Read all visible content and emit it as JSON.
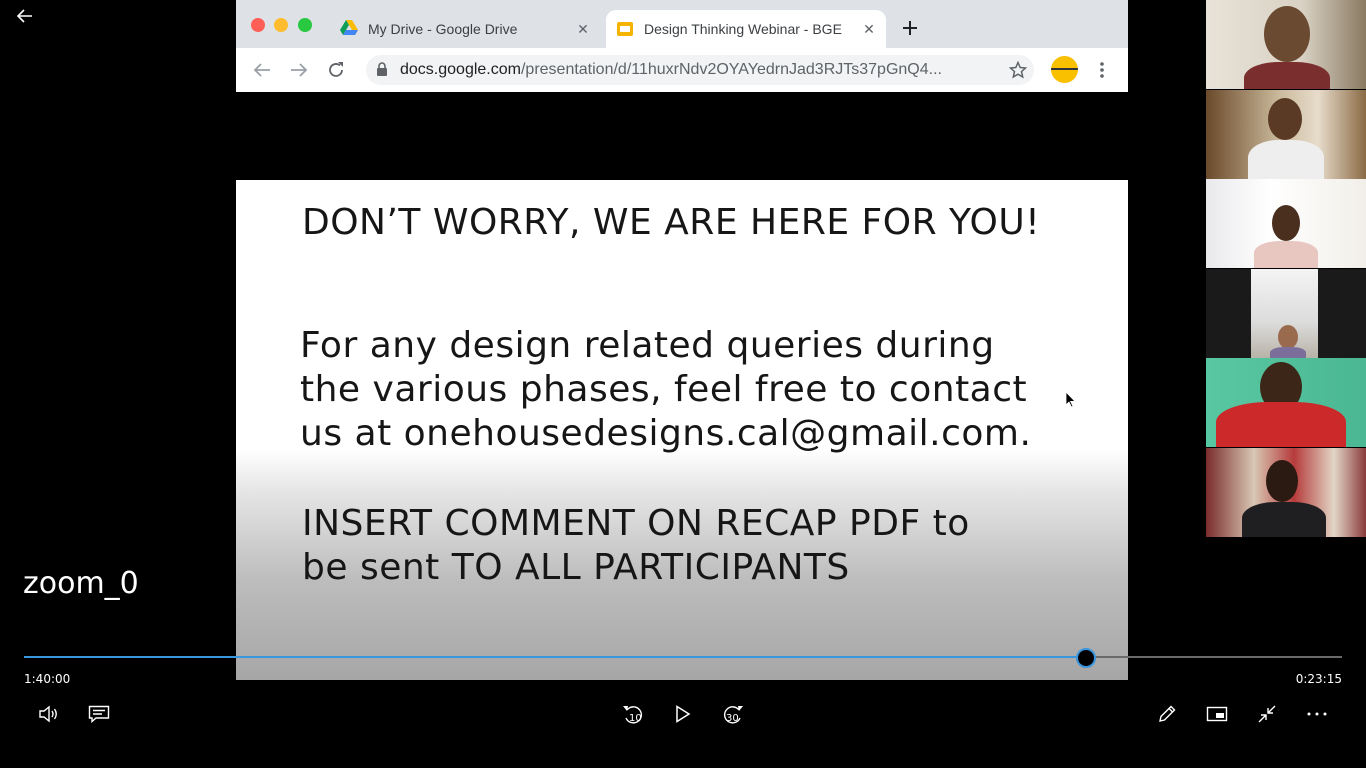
{
  "player": {
    "recording_title": "zoom_0",
    "elapsed_time": "1:40:00",
    "remaining_time": "0:23:15",
    "progress_fraction": 0.806,
    "skip_back_seconds": "10",
    "skip_forward_seconds": "30",
    "accent_color": "#3a96dd",
    "controls": [
      "back-arrow-icon",
      "volume-icon",
      "captions-icon",
      "skip-back-icon",
      "play-icon",
      "skip-forward-icon",
      "pen-icon",
      "mini-view-icon",
      "exit-fullscreen-icon",
      "more-icon"
    ]
  },
  "browser": {
    "tabs": [
      {
        "title": "My Drive - Google Drive",
        "icon": "google-drive-icon",
        "active": false
      },
      {
        "title": "Design Thinking Webinar - BGE",
        "icon": "google-slides-icon",
        "active": true
      }
    ],
    "url_host": "docs.google.com",
    "url_path": "/presentation/d/11huxrNdv2OYAYedrnJad3RJTs37pGnQ4..."
  },
  "slide": {
    "heading": "DON’T WORRY, WE ARE HERE FOR YOU!",
    "body_lines": [
      "For any design related queries during",
      "the various phases, feel free to contact",
      "us at onehousedesigns.cal@gmail.com."
    ],
    "note_lines": [
      "INSERT COMMENT ON RECAP PDF to",
      "be sent TO ALL PARTICIPANTS"
    ]
  },
  "participants_count": 6
}
